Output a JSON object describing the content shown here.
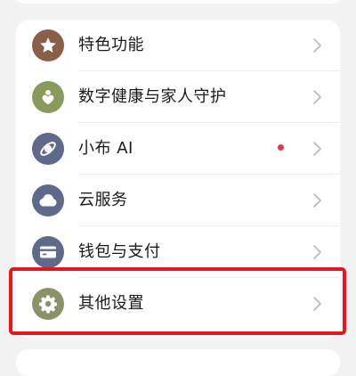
{
  "settings": {
    "items": [
      {
        "label": "特色功能",
        "icon": "star-icon",
        "icon_color": "#8a5f4a"
      },
      {
        "label": "数字健康与家人守护",
        "icon": "heart-person-icon",
        "icon_color": "#899a5b"
      },
      {
        "label": "小布 AI",
        "icon": "ai-assistant-icon",
        "icon_color": "#5f6a8a",
        "badge": "red-dot"
      },
      {
        "label": "云服务",
        "icon": "cloud-icon",
        "icon_color": "#5f6a8a"
      },
      {
        "label": "钱包与支付",
        "icon": "wallet-card-icon",
        "icon_color": "#5f6a8a"
      },
      {
        "label": "其他设置",
        "icon": "gear-icon",
        "icon_color": "#8b9269",
        "highlighted": true
      }
    ]
  },
  "colors": {
    "background": "#f2f2f2",
    "card": "#ffffff",
    "badge_dot": "#d83a4c",
    "highlight_border": "#e31919"
  }
}
